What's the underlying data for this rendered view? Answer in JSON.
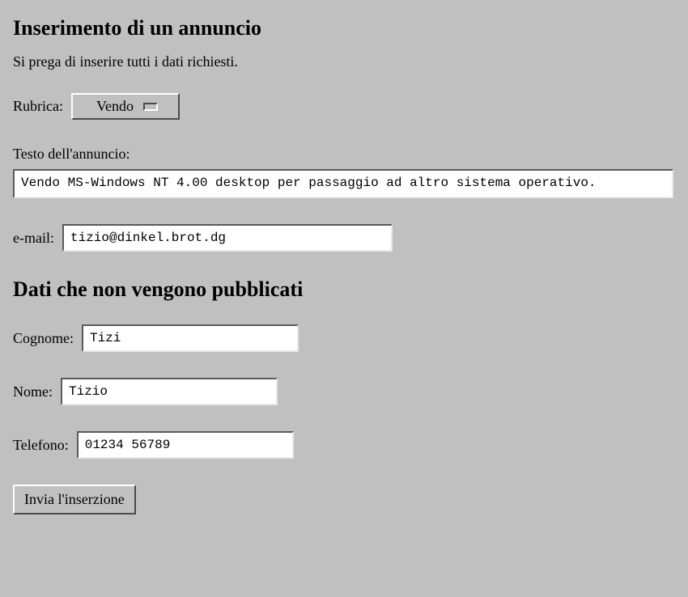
{
  "heading1": "Inserimento di un annuncio",
  "intro": "Si prega di inserire tutti i dati richiesti.",
  "rubrica": {
    "label": "Rubrica:",
    "selected": "Vendo"
  },
  "testo": {
    "label": "Testo dell'annuncio:",
    "value": "Vendo MS-Windows NT 4.00 desktop per passaggio ad altro sistema operativo."
  },
  "email": {
    "label": "e-mail:",
    "value": "tizio@dinkel.brot.dg"
  },
  "heading2": "Dati che non vengono pubblicati",
  "cognome": {
    "label": "Cognome:",
    "value": "Tizi"
  },
  "nome": {
    "label": "Nome:",
    "value": "Tizio"
  },
  "telefono": {
    "label": "Telefono:",
    "value": "01234 56789"
  },
  "submit_label": "Invia l'inserzione"
}
